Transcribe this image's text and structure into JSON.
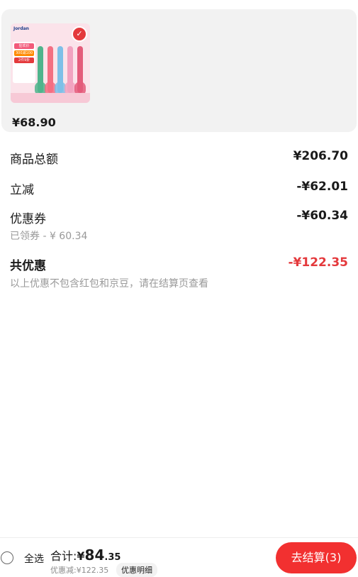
{
  "product": {
    "thumb_brand": "Jordan",
    "thumb_promo": [
      "300减100",
      "2件9折",
      "狂欢价"
    ],
    "price": "¥68.90"
  },
  "summary": {
    "goods_total_label": "商品总额",
    "goods_total_value": "¥206.70",
    "instant_cut_label": "立减",
    "instant_cut_value": "-¥62.01",
    "coupon_label": "优惠券",
    "coupon_value": "-¥60.34",
    "coupon_sub": "已领券 - ¥ 60.34",
    "total_discount_label": "共优惠",
    "total_discount_value": "-¥122.35",
    "note": "以上优惠不包含红包和京豆，请在结算页查看"
  },
  "bottom_bar": {
    "select_all": "全选",
    "total_label": "合计:",
    "currency": "¥",
    "total_int": "84",
    "total_dec": ".35",
    "discount_line": "优惠减:¥122.35",
    "detail_link": "优惠明细",
    "checkout": "去结算(3)"
  },
  "colors": {
    "accent_red": "#e4393c",
    "checkout_red": "#f23030"
  }
}
